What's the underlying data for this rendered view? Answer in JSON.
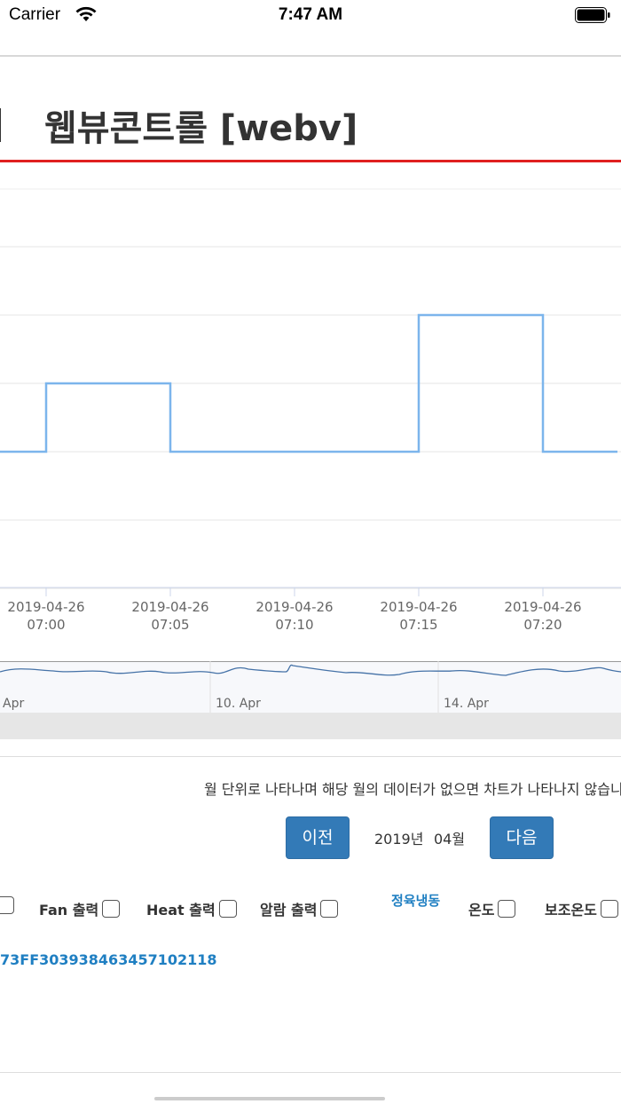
{
  "status_bar": {
    "carrier": "Carrier",
    "time": "7:47 AM"
  },
  "header": {
    "title": "웹뷰콘트롤 [webv]"
  },
  "chart_data": {
    "type": "line",
    "x_ticks": [
      {
        "date": "2019-04-26",
        "time": "07:00"
      },
      {
        "date": "2019-04-26",
        "time": "07:05"
      },
      {
        "date": "2019-04-26",
        "time": "07:10"
      },
      {
        "date": "2019-04-26",
        "time": "07:15"
      },
      {
        "date": "2019-04-26",
        "time": "07:20"
      }
    ],
    "series": [
      {
        "step": true,
        "color": "#7cb5ec",
        "points": [
          [
            -2,
            0
          ],
          [
            0,
            0
          ],
          [
            0,
            1
          ],
          [
            5,
            1
          ],
          [
            5,
            0
          ],
          [
            15,
            0
          ],
          [
            15,
            2
          ],
          [
            20,
            2
          ],
          [
            20,
            0
          ],
          [
            23,
            0
          ]
        ]
      }
    ],
    "grid": true
  },
  "navigator": {
    "labels": [
      "Apr",
      "10. Apr",
      "14. Apr"
    ]
  },
  "notice": "월 단위로 나타나며 해당 월의 데이터가 없으면 차트가 나타나지 않습니",
  "nav_controls": {
    "prev": "이전",
    "year": "2019년",
    "month": "04월",
    "next": "다음"
  },
  "options": {
    "fan": "Fan 출력",
    "heat": "Heat 출력",
    "alarm": "알람 출력",
    "category": "정육냉동",
    "temp": "온도",
    "aux_temp": "보조온도"
  },
  "device_serial": "73FF303938463457102118"
}
